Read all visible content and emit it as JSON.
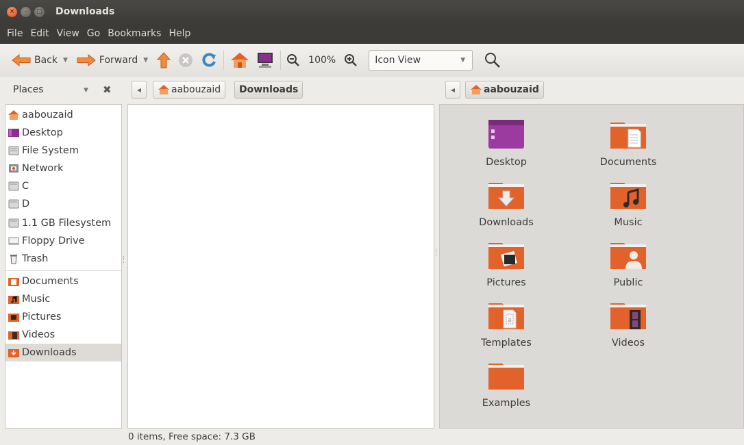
{
  "window": {
    "title": "Downloads"
  },
  "menu": [
    "File",
    "Edit",
    "View",
    "Go",
    "Bookmarks",
    "Help"
  ],
  "toolbar": {
    "back_label": "Back",
    "forward_label": "Forward",
    "zoom_level": "100%",
    "view_mode": "Icon View"
  },
  "places": {
    "header": "Places",
    "items": [
      {
        "label": "aabouzaid",
        "icon": "home-folder-icon"
      },
      {
        "label": "Desktop",
        "icon": "desktop-icon"
      },
      {
        "label": "File System",
        "icon": "harddisk-icon"
      },
      {
        "label": "Network",
        "icon": "network-icon"
      },
      {
        "label": "C",
        "icon": "drive-icon"
      },
      {
        "label": "D",
        "icon": "drive-icon"
      },
      {
        "label": "1.1 GB Filesystem",
        "icon": "drive-icon"
      },
      {
        "label": "Floppy Drive",
        "icon": "floppy-icon"
      },
      {
        "label": "Trash",
        "icon": "trash-icon"
      },
      {
        "label": "Documents",
        "icon": "documents-icon"
      },
      {
        "label": "Music",
        "icon": "music-icon"
      },
      {
        "label": "Pictures",
        "icon": "pictures-icon"
      },
      {
        "label": "Videos",
        "icon": "videos-icon"
      },
      {
        "label": "Downloads",
        "icon": "downloads-icon",
        "selected": true
      }
    ]
  },
  "left_pane": {
    "path": [
      "aabouzaid",
      "Downloads"
    ],
    "status": "0 items, Free space: 7.3 GB"
  },
  "right_pane": {
    "path": [
      "aabouzaid"
    ],
    "folders": [
      {
        "label": "Desktop",
        "icon": "desktop-folder-icon"
      },
      {
        "label": "Documents",
        "icon": "documents-folder-icon"
      },
      {
        "label": "Downloads",
        "icon": "downloads-folder-icon"
      },
      {
        "label": "Music",
        "icon": "music-folder-icon"
      },
      {
        "label": "Pictures",
        "icon": "pictures-folder-icon"
      },
      {
        "label": "Public",
        "icon": "public-folder-icon"
      },
      {
        "label": "Templates",
        "icon": "templates-folder-icon"
      },
      {
        "label": "Videos",
        "icon": "videos-folder-icon"
      },
      {
        "label": "Examples",
        "icon": "examples-folder-icon"
      }
    ]
  },
  "colors": {
    "accent_orange": "#e2622b",
    "titlebar": "#3c3b37",
    "selection": "#dedbd6"
  }
}
